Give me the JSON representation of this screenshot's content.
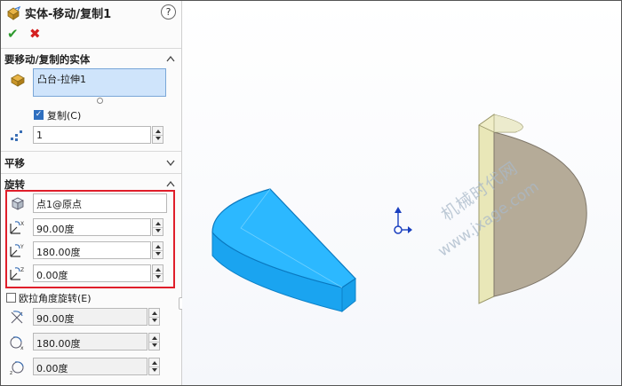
{
  "panel": {
    "title": "实体-移动/复制1",
    "help": "?",
    "ok": "✔",
    "cancel": "✖",
    "bodies_section": {
      "title": "要移动/复制的实体",
      "selected_item": "凸台-拉伸1"
    },
    "copy_checkbox": {
      "label": "复制(C)",
      "checked": true
    },
    "copies": {
      "value": "1"
    },
    "translate_section": {
      "title": "平移"
    },
    "rotate_section": {
      "title": "旋转",
      "origin": "点1@原点",
      "x_angle": "90.00度",
      "y_angle": "180.00度",
      "z_angle": "0.00度"
    },
    "euler_checkbox": {
      "label": "欧拉角度旋转(E)",
      "checked": false
    },
    "euler_fields": [
      "90.00度",
      "180.00度",
      "0.00度"
    ]
  },
  "viewport": {
    "watermark_line1": "机械时代网",
    "watermark_line2": "www.jxage.com"
  }
}
